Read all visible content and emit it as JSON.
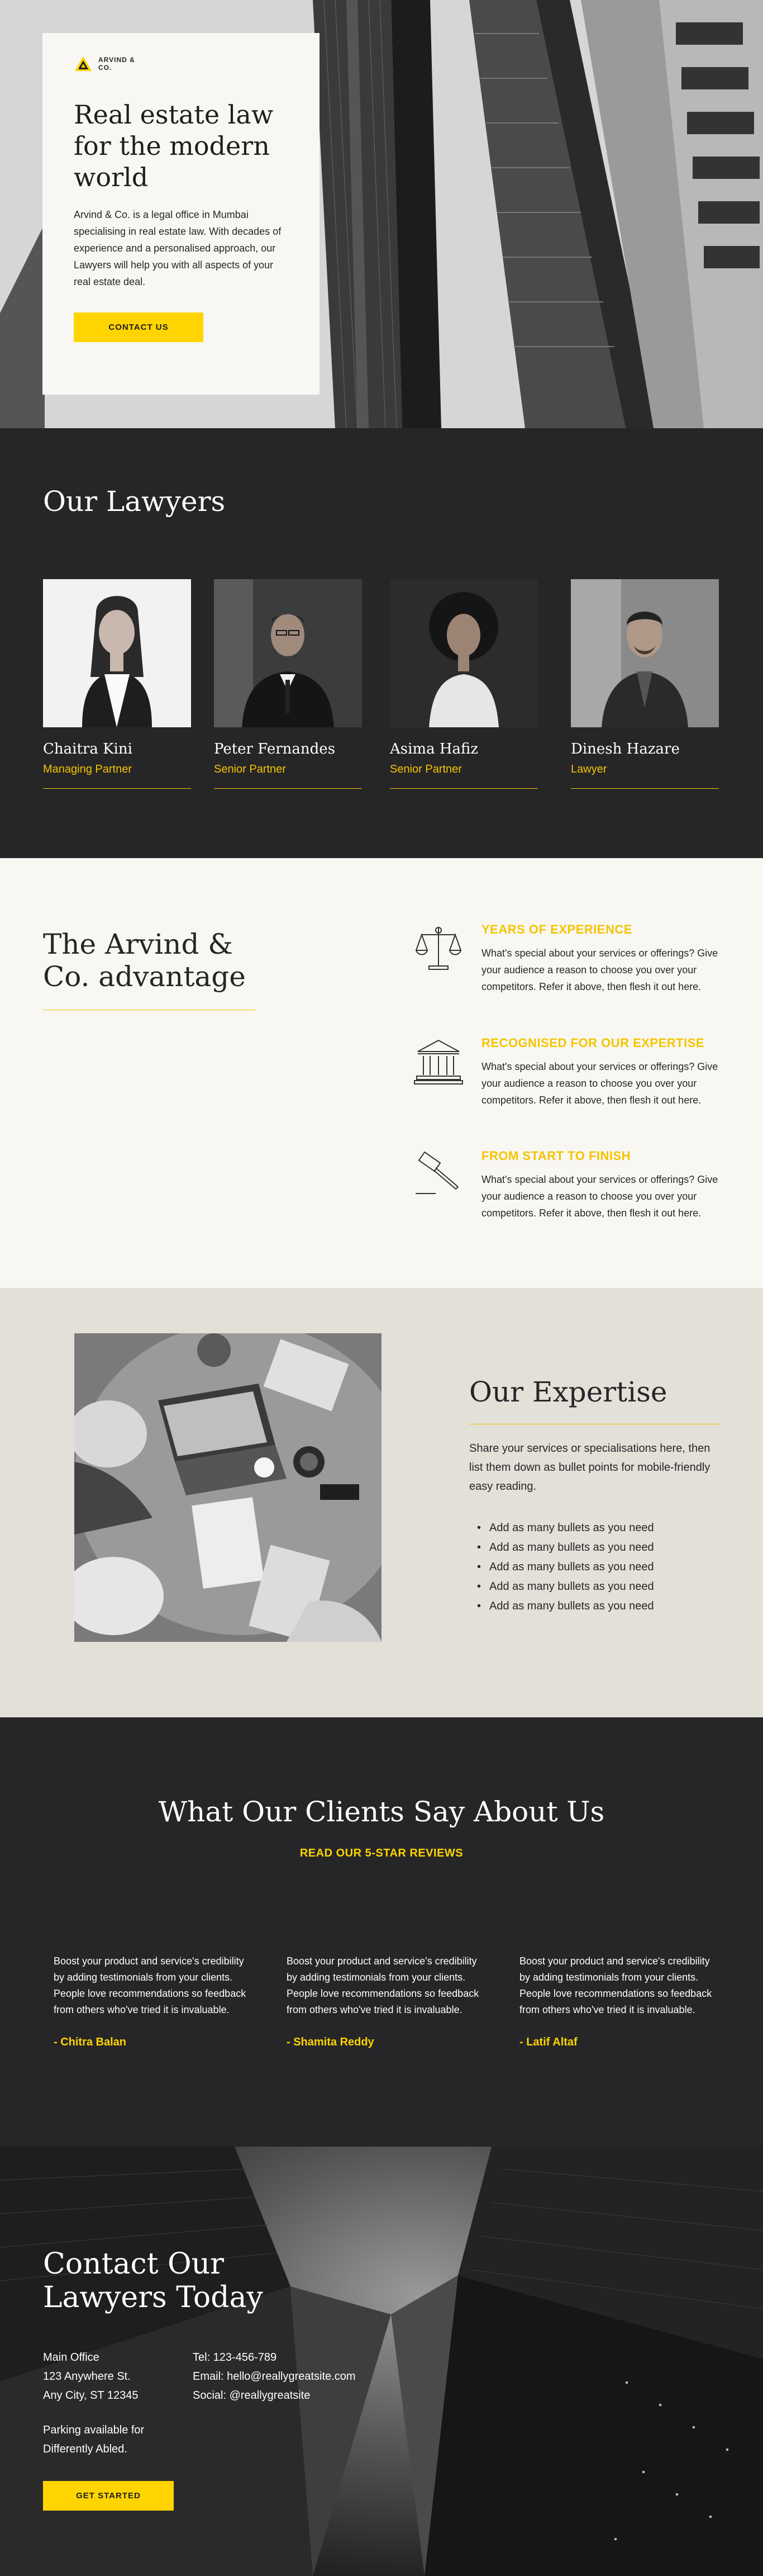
{
  "hero": {
    "logo_text": "ARVIND & CO.",
    "title": "Real estate law for the modern world",
    "description": "Arvind & Co. is a legal office in Mumbai specialising in real estate law. With decades of experience and a personalised approach, our Lawyers will help you with all aspects of your real estate deal.",
    "cta_label": "CONTACT US"
  },
  "lawyers": {
    "title": "Our Lawyers",
    "items": [
      {
        "name": "Chaitra Kini",
        "role": "Managing Partner"
      },
      {
        "name": "Peter Fernandes",
        "role": "Senior Partner"
      },
      {
        "name": "Asima Hafiz",
        "role": "Senior Partner"
      },
      {
        "name": "Dinesh Hazare",
        "role": "Lawyer"
      }
    ]
  },
  "advantage": {
    "title": "The Arvind & Co. advantage",
    "items": [
      {
        "icon": "scales-icon",
        "heading": "YEARS OF EXPERIENCE",
        "body": "What's special about your services or offerings? Give your audience a reason to choose you over your competitors. Refer it above, then flesh it out here."
      },
      {
        "icon": "courthouse-icon",
        "heading": "RECOGNISED FOR OUR EXPERTISE",
        "body": "What's special about your services or offerings? Give your audience a reason to choose you over your competitors. Refer it above, then flesh it out here."
      },
      {
        "icon": "gavel-icon",
        "heading": "FROM START TO FINISH",
        "body": "What's special about your services or offerings? Give your audience a reason to choose you over your competitors. Refer it above, then flesh it out here."
      }
    ]
  },
  "expertise": {
    "title": "Our Expertise",
    "description": "Share your services or specialisations here, then list them down as bullet points for mobile-friendly easy reading.",
    "bullets": [
      "Add as many bullets as you need",
      "Add as many bullets as you need",
      "Add as many bullets as you need",
      "Add as many bullets as you need",
      "Add as many bullets as you need"
    ]
  },
  "testimonials": {
    "title": "What Our Clients Say About Us",
    "subtitle": "READ OUR 5-STAR REVIEWS",
    "items": [
      {
        "quote": "Boost your product and service's credibility by adding testimonials from your clients. People love recommendations so feedback from others who've tried it is invaluable.",
        "author": "- Chitra Balan"
      },
      {
        "quote": "Boost your product and service's credibility by adding testimonials from your clients. People love recommendations so feedback from others who've tried it is invaluable.",
        "author": "- Shamita Reddy"
      },
      {
        "quote": "Boost your product and service's credibility by adding testimonials from your clients. People love recommendations so feedback from others who've tried it is invaluable.",
        "author": "- Latif Altaf"
      }
    ]
  },
  "contact": {
    "title": "Contact Our Lawyers Today",
    "address": [
      "Main Office",
      "123 Anywhere St.",
      "Any City, ST 12345"
    ],
    "details": [
      "Tel: 123-456-789",
      "Email: hello@reallygreatsite.com",
      "Social: @reallygreatsite"
    ],
    "parking": [
      "Parking available for",
      "Differently Abled."
    ],
    "cta_label": "GET STARTED"
  },
  "colors": {
    "accent": "#ffd400",
    "dark": "#262628",
    "cream": "#f8f7f2",
    "stone": "#e3e0d8"
  }
}
